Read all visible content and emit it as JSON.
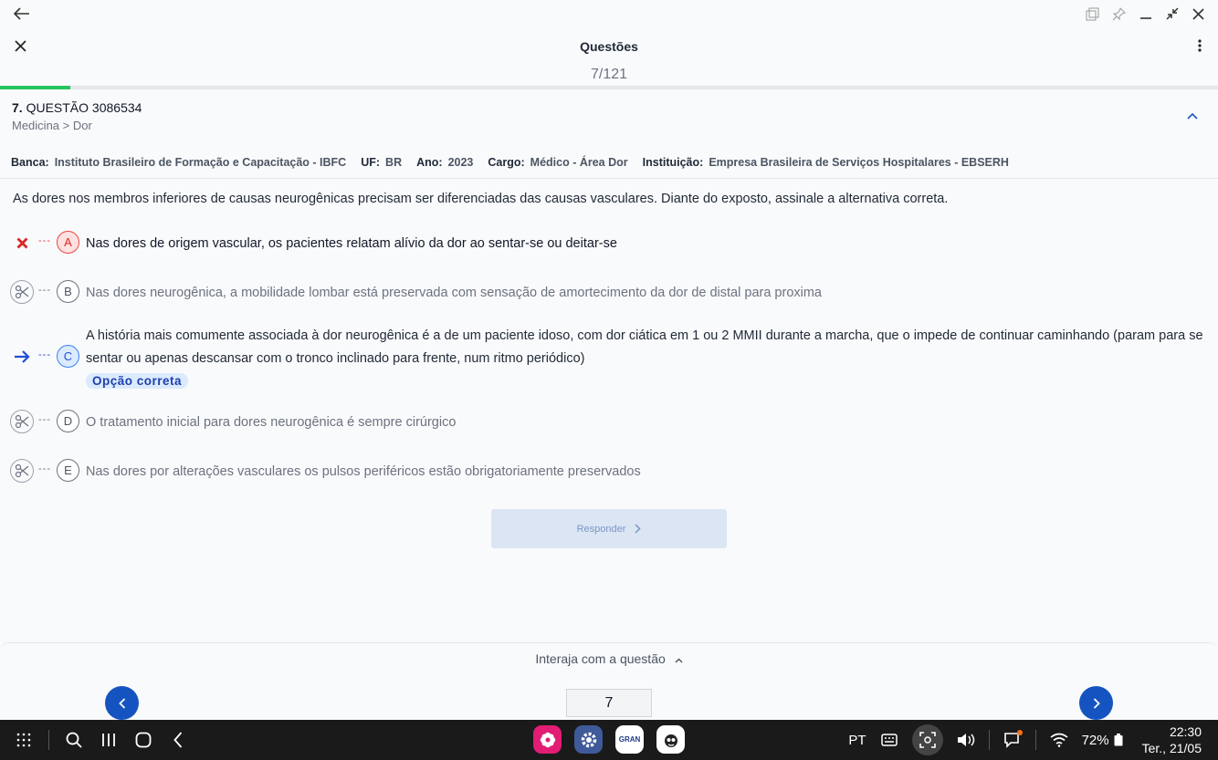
{
  "window": {
    "back_icon": "arrow-left-icon",
    "controls": [
      "popup-icon",
      "pin-icon",
      "minimize-icon",
      "shrink-icon",
      "close-icon"
    ]
  },
  "header": {
    "title": "Questões",
    "counter": "7/121",
    "progress_fraction": 0.058
  },
  "question": {
    "number": "7.",
    "label": "QUESTÃO 3086534",
    "path": "Medicina > Dor",
    "meta": {
      "banca_key": "Banca:",
      "banca_val": "Instituto Brasileiro de Formação e Capacitação - IBFC",
      "uf_key": "UF:",
      "uf_val": "BR",
      "ano_key": "Ano:",
      "ano_val": "2023",
      "cargo_key": "Cargo:",
      "cargo_val": "Médico - Área Dor",
      "inst_key": "Instituição:",
      "inst_val": "Empresa Brasileira de Serviços Hospitalares - EBSERH"
    },
    "statement": "As dores nos membros inferiores de causas neurogênicas precisam ser diferenciadas das causas vasculares. Diante do exposto, assinale a alternativa correta.",
    "alternatives": [
      {
        "letter": "A",
        "state": "wrong",
        "text": "Nas dores de origem vascular, os pacientes relatam alívio da dor ao sentar-se ou deitar-se"
      },
      {
        "letter": "B",
        "state": "neutral",
        "text": "Nas dores neurogênica, a mobilidade lombar está preservada com sensação de amortecimento da dor de distal para proxima"
      },
      {
        "letter": "C",
        "state": "correct",
        "text": "A história mais comumente associada à dor neurogênica é a de um paciente idoso, com dor ciática em 1 ou 2 MMII durante a marcha, que o impede de continuar caminhando (param para se sentar ou apenas descansar com o tronco inclinado para frente, num ritmo periódico)"
      },
      {
        "letter": "D",
        "state": "neutral",
        "text": "O tratamento inicial para dores neurogênica é sempre cirúrgico"
      },
      {
        "letter": "E",
        "state": "neutral",
        "text": "Nas dores por alterações vasculares os pulsos periféricos estão obrigatoriamente preservados"
      }
    ],
    "correct_badge": "Opção correta",
    "answer_button": "Responder",
    "dash": "---"
  },
  "footer": {
    "interact_label": "Interaja com a questão",
    "page_value": "7"
  },
  "taskbar": {
    "language": "PT",
    "battery": "72%",
    "time": "22:30",
    "date": "Ter., 21/05",
    "apps": [
      "flower-app-icon",
      "settings-app-icon",
      "gran-app-icon",
      "mascot-app-icon"
    ],
    "gran_label": "GRAN"
  },
  "colors": {
    "accent": "#1554c0",
    "progress": "#22c55e",
    "wrong": "#ef4444",
    "correct": "#3b82f6"
  }
}
